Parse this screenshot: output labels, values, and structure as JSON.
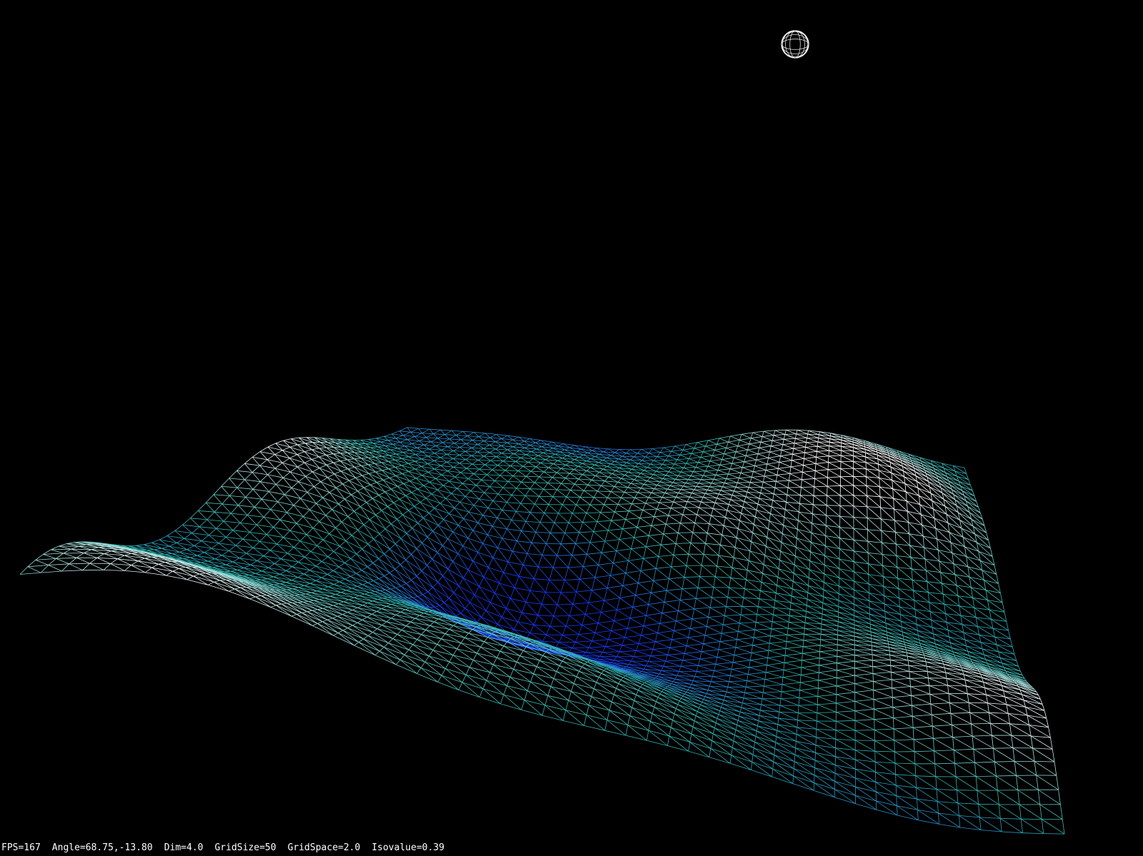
{
  "window": {
    "background": "#000000"
  },
  "scene": {
    "description_icon": "wireframe-terrain",
    "light_icon": "wireframe-sphere-icon",
    "colors": {
      "low": "#1a3cff",
      "mid": "#2fb5b0",
      "high": "#ffffff",
      "light": "#ffffff"
    }
  },
  "hud": {
    "fps": "FPS=167",
    "angle": "Angle=68.75,-13.80",
    "dim": "Dim=4.0",
    "grid_size": "GridSize=50",
    "grid_space": "GridSpace=2.0",
    "isovalue": "Isovalue=0.39"
  }
}
